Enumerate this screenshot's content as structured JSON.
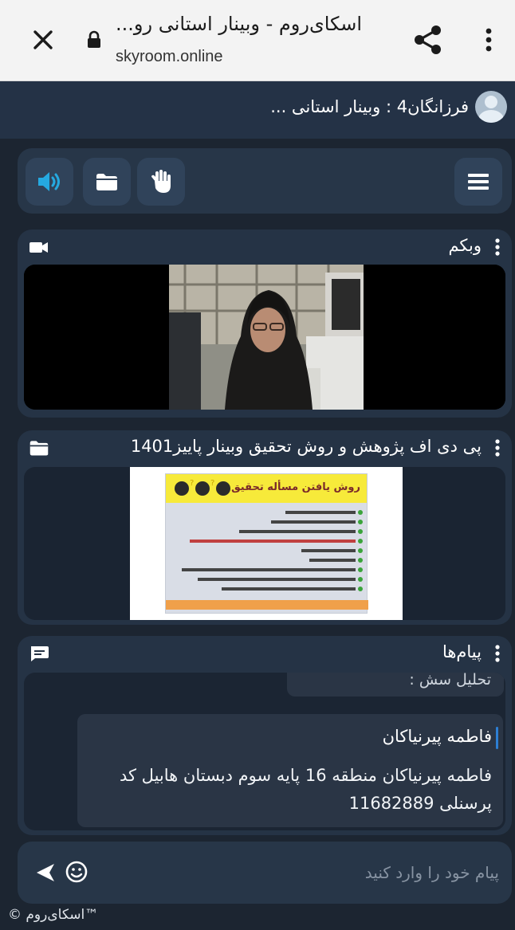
{
  "browser": {
    "title": "اسکای‌روم - وبینار استانی رو...",
    "url": "skyroom.online"
  },
  "room": {
    "title": "فرزانگان4 : وبینار استانی ..."
  },
  "toolbar": {
    "icons": [
      "menu-icon",
      "hand-icon",
      "folder-icon",
      "speaker-icon"
    ],
    "accent": "#25a9e0"
  },
  "webcam_panel": {
    "title": "وبکم"
  },
  "document_panel": {
    "title": "پی دی اف پژوهش و روش تحقیق وبینار پاییز1401",
    "slide": {
      "heading": "روش یافتن مسأله تحقیق"
    }
  },
  "chat_panel": {
    "title": "پیام‌ها",
    "previous_message": "تحلیل سش :",
    "message": {
      "sender": "فاطمه پیرنیاکان",
      "text": "فاطمه پیرنیاکان منطقه 16 پایه سوم دبستان هابیل کد پرسنلی 11682889"
    },
    "input_placeholder": "پیام خود را وارد کنید"
  },
  "footer": {
    "brand": "™اسکای‌روم ©"
  }
}
